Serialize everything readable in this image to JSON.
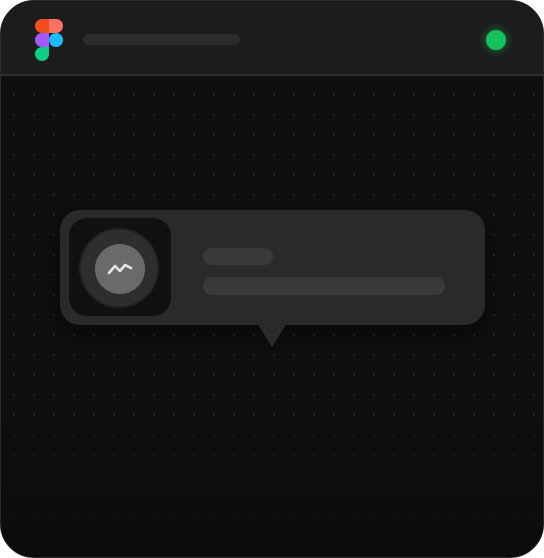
{
  "titlebar": {
    "logo_icon": "figma-logo-icon",
    "status_color": "#19c15b"
  },
  "notification": {
    "app_icon": "activity-trend-icon",
    "background_color": "#2a2a2a"
  },
  "theme": {
    "window_background": "#0d0d0d",
    "titlebar_background": "#1c1c1c",
    "placeholder_color": "#3a3a3a"
  }
}
